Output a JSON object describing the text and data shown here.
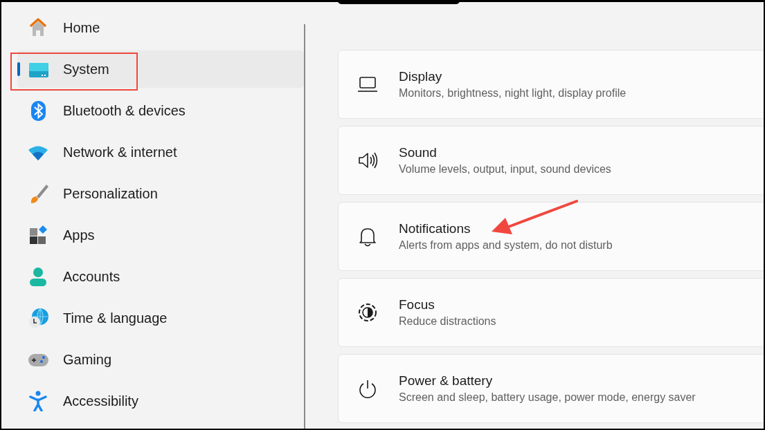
{
  "sidebar": {
    "items": [
      {
        "label": "Home",
        "selected": false
      },
      {
        "label": "System",
        "selected": true
      },
      {
        "label": "Bluetooth & devices",
        "selected": false
      },
      {
        "label": "Network & internet",
        "selected": false
      },
      {
        "label": "Personalization",
        "selected": false
      },
      {
        "label": "Apps",
        "selected": false
      },
      {
        "label": "Accounts",
        "selected": false
      },
      {
        "label": "Time & language",
        "selected": false
      },
      {
        "label": "Gaming",
        "selected": false
      },
      {
        "label": "Accessibility",
        "selected": false
      }
    ]
  },
  "settings": [
    {
      "title": "Display",
      "description": "Monitors, brightness, night light, display profile"
    },
    {
      "title": "Sound",
      "description": "Volume levels, output, input, sound devices"
    },
    {
      "title": "Notifications",
      "description": "Alerts from apps and system, do not disturb"
    },
    {
      "title": "Focus",
      "description": "Reduce distractions"
    },
    {
      "title": "Power & battery",
      "description": "Screen and sleep, battery usage, power mode, energy saver"
    }
  ]
}
